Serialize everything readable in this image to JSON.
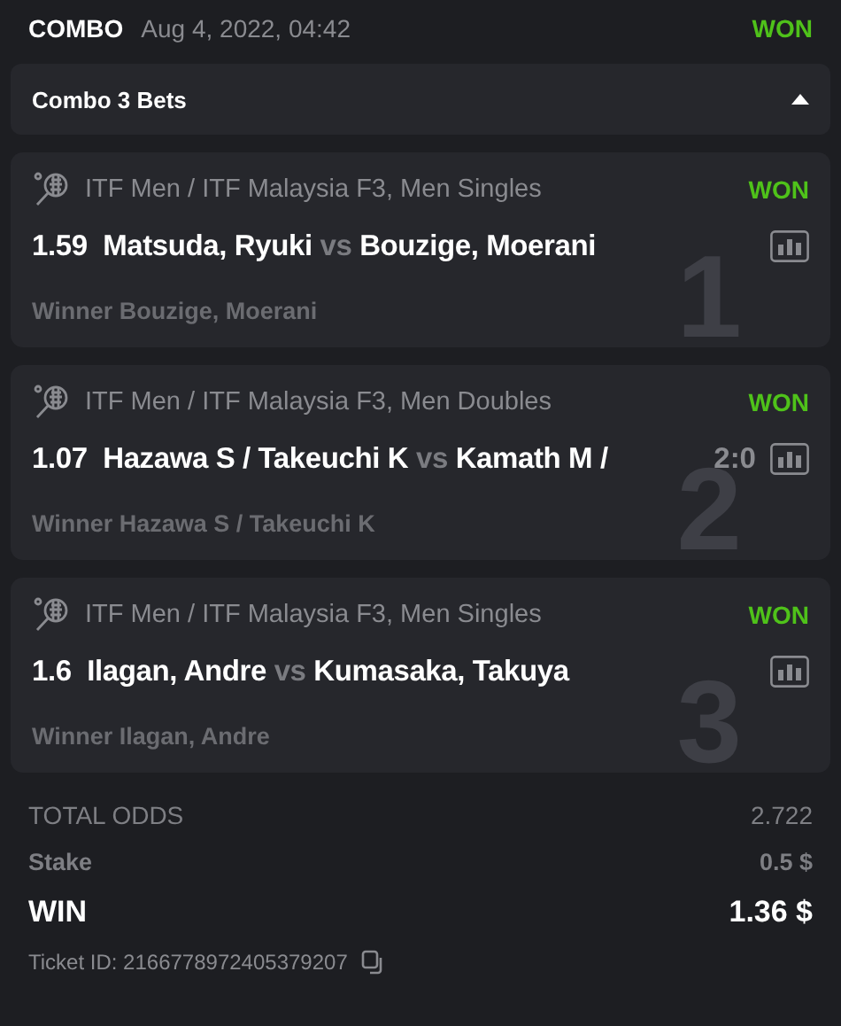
{
  "header": {
    "type": "COMBO",
    "date": "Aug 4, 2022, 04:42",
    "status": "WON",
    "won": true
  },
  "combo_bar": {
    "title": "Combo 3 Bets",
    "expanded": true
  },
  "bets": [
    {
      "index": "1",
      "league": "ITF Men / ITF Malaysia F3, Men Singles",
      "status": "WON",
      "won": true,
      "odds": "1.59",
      "team1": "Matsuda, Ryuki",
      "vs": "vs",
      "team2": "Bouzige, Moerani",
      "pick": "Winner Bouzige, Moerani"
    },
    {
      "index": "2",
      "league": "ITF Men / ITF Malaysia F3, Men Doubles",
      "status": "WON",
      "won": true,
      "odds": "1.07",
      "team1": "Hazawa S / Takeuchi K",
      "vs": "vs",
      "team2": "Kamath M /",
      "score": "2:0",
      "pick": "Winner Hazawa S / Takeuchi K"
    },
    {
      "index": "3",
      "league": "ITF Men / ITF Malaysia F3, Men Singles",
      "status": "WON",
      "won": true,
      "odds": "1.6",
      "team1": "Ilagan, Andre",
      "vs": "vs",
      "team2": "Kumasaka, Takuya",
      "pick": "Winner Ilagan, Andre"
    }
  ],
  "summary": {
    "total_odds_label": "TOTAL ODDS",
    "total_odds": "2.722",
    "stake_label": "Stake",
    "stake": "0.5 $",
    "win_label": "WIN",
    "win": "1.36 $"
  },
  "ticket": "Ticket ID: 2166778972405379207"
}
